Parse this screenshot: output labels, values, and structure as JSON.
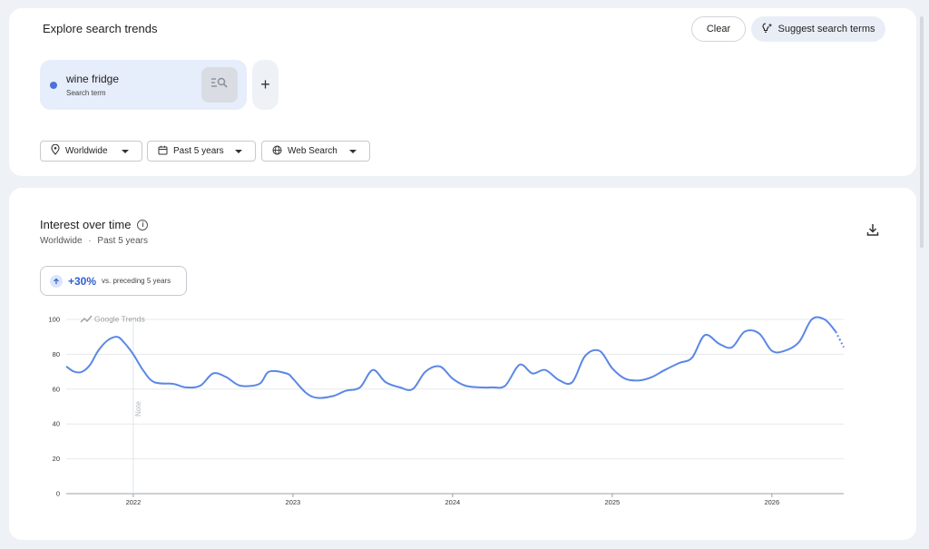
{
  "header": {
    "title": "Explore search trends",
    "clear_label": "Clear",
    "suggest_label": "Suggest search terms"
  },
  "term": {
    "name": "wine fridge",
    "type": "Search term",
    "color": "#4b72d8"
  },
  "add_term_label": "+",
  "filters": {
    "location": "Worldwide",
    "time_range": "Past 5 years",
    "property": "Web Search"
  },
  "chart_panel": {
    "title": "Interest over time",
    "location": "Worldwide",
    "separator": "·",
    "time_range": "Past 5 years",
    "change_value": "+30%",
    "change_note": "vs. preceding 5 years",
    "watermark": "Google Trends",
    "note_label": "Note"
  },
  "icons": {
    "term_explore": "explore-list-icon",
    "suggest": "sparkle-bulb-icon",
    "location": "location-pin-icon",
    "calendar": "calendar-icon",
    "globe": "globe-icon",
    "info": "info-icon",
    "download": "download-icon",
    "trend_up": "arrow-up-icon"
  },
  "chart_data": {
    "type": "line",
    "title": "",
    "xlabel": "",
    "ylabel": "",
    "ylim": [
      0,
      100
    ],
    "yticks": [
      0,
      20,
      40,
      60,
      80,
      100
    ],
    "xticks": [
      "2022",
      "2023",
      "2024",
      "2025",
      "2026"
    ],
    "xtick_years": [
      2022,
      2023,
      2024,
      2025,
      2026
    ],
    "grid": true,
    "series": [
      {
        "color": "#5b87e6",
        "x": [
          2021.58,
          2021.63,
          2021.68,
          2021.73,
          2021.78,
          2021.84,
          2021.9,
          2021.94,
          2022.0,
          2022.06,
          2022.13,
          2022.25,
          2022.33,
          2022.42,
          2022.5,
          2022.58,
          2022.67,
          2022.79,
          2022.85,
          2022.96,
          2023.0,
          2023.08,
          2023.15,
          2023.25,
          2023.33,
          2023.42,
          2023.5,
          2023.58,
          2023.67,
          2023.75,
          2023.83,
          2023.92,
          2024.0,
          2024.08,
          2024.17,
          2024.25,
          2024.33,
          2024.42,
          2024.5,
          2024.58,
          2024.67,
          2024.75,
          2024.83,
          2024.92,
          2025.0,
          2025.08,
          2025.17,
          2025.25,
          2025.33,
          2025.42,
          2025.5,
          2025.58,
          2025.67,
          2025.75,
          2025.83,
          2025.92,
          2026.0,
          2026.08,
          2026.17,
          2026.25,
          2026.33,
          2026.4,
          2026.45
        ],
        "values": [
          73,
          70,
          70,
          74,
          82,
          88,
          90,
          87,
          80,
          71,
          64,
          63,
          61,
          62,
          69,
          67,
          62,
          63,
          70,
          69,
          66,
          58,
          55,
          56,
          59,
          61,
          71,
          64,
          61,
          60,
          70,
          73,
          66,
          62,
          61,
          61,
          62,
          74,
          69,
          71,
          65,
          64,
          79,
          82,
          72,
          66,
          65,
          67,
          71,
          75,
          78,
          91,
          86,
          84,
          93,
          92,
          82,
          82,
          87,
          100,
          100,
          93,
          84
        ],
        "partial_from_index": 61
      }
    ]
  }
}
